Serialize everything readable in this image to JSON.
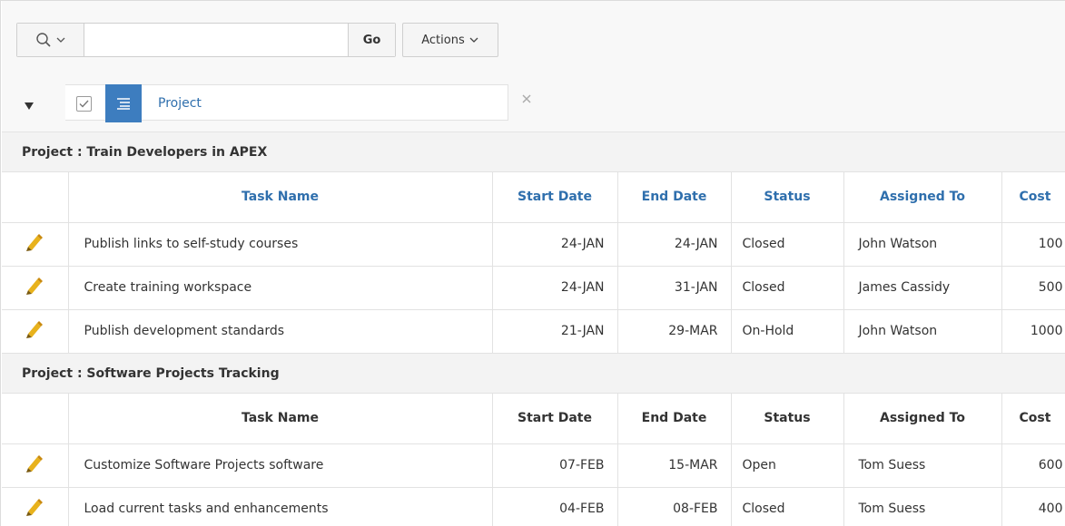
{
  "toolbar": {
    "search_placeholder": "",
    "go_label": "Go",
    "actions_label": "Actions"
  },
  "filter": {
    "label": "Project"
  },
  "columns": {
    "task_name": "Task Name",
    "start_date": "Start Date",
    "end_date": "End Date",
    "status": "Status",
    "assigned_to": "Assigned To",
    "cost": "Cost"
  },
  "groups": [
    {
      "label": "Project : Train Developers in APEX",
      "rows": [
        {
          "task": "Publish links to self-study courses",
          "start": "24-JAN",
          "end": "24-JAN",
          "status": "Closed",
          "assigned": "John Watson",
          "cost": "100"
        },
        {
          "task": "Create training workspace",
          "start": "24-JAN",
          "end": "31-JAN",
          "status": "Closed",
          "assigned": "James Cassidy",
          "cost": "500"
        },
        {
          "task": "Publish development standards",
          "start": "21-JAN",
          "end": "29-MAR",
          "status": "On-Hold",
          "assigned": "John Watson",
          "cost": "1000"
        }
      ]
    },
    {
      "label": "Project : Software Projects Tracking",
      "rows": [
        {
          "task": "Customize Software Projects software",
          "start": "07-FEB",
          "end": "15-MAR",
          "status": "Open",
          "assigned": "Tom Suess",
          "cost": "600"
        },
        {
          "task": "Load current tasks and enhancements",
          "start": "04-FEB",
          "end": "08-FEB",
          "status": "Closed",
          "assigned": "Tom Suess",
          "cost": "400"
        }
      ]
    }
  ],
  "colors": {
    "accent": "#3d7dbf",
    "link": "#2f6fad",
    "pencil": "#e8b21c"
  },
  "icons": {
    "search": "search-icon",
    "dropdown": "chevron-down-icon",
    "filter_checkbox": "checkbox-checked-icon",
    "filter_type": "filter-lines-icon",
    "remove_filter": "close-icon",
    "edit": "pencil-icon"
  }
}
